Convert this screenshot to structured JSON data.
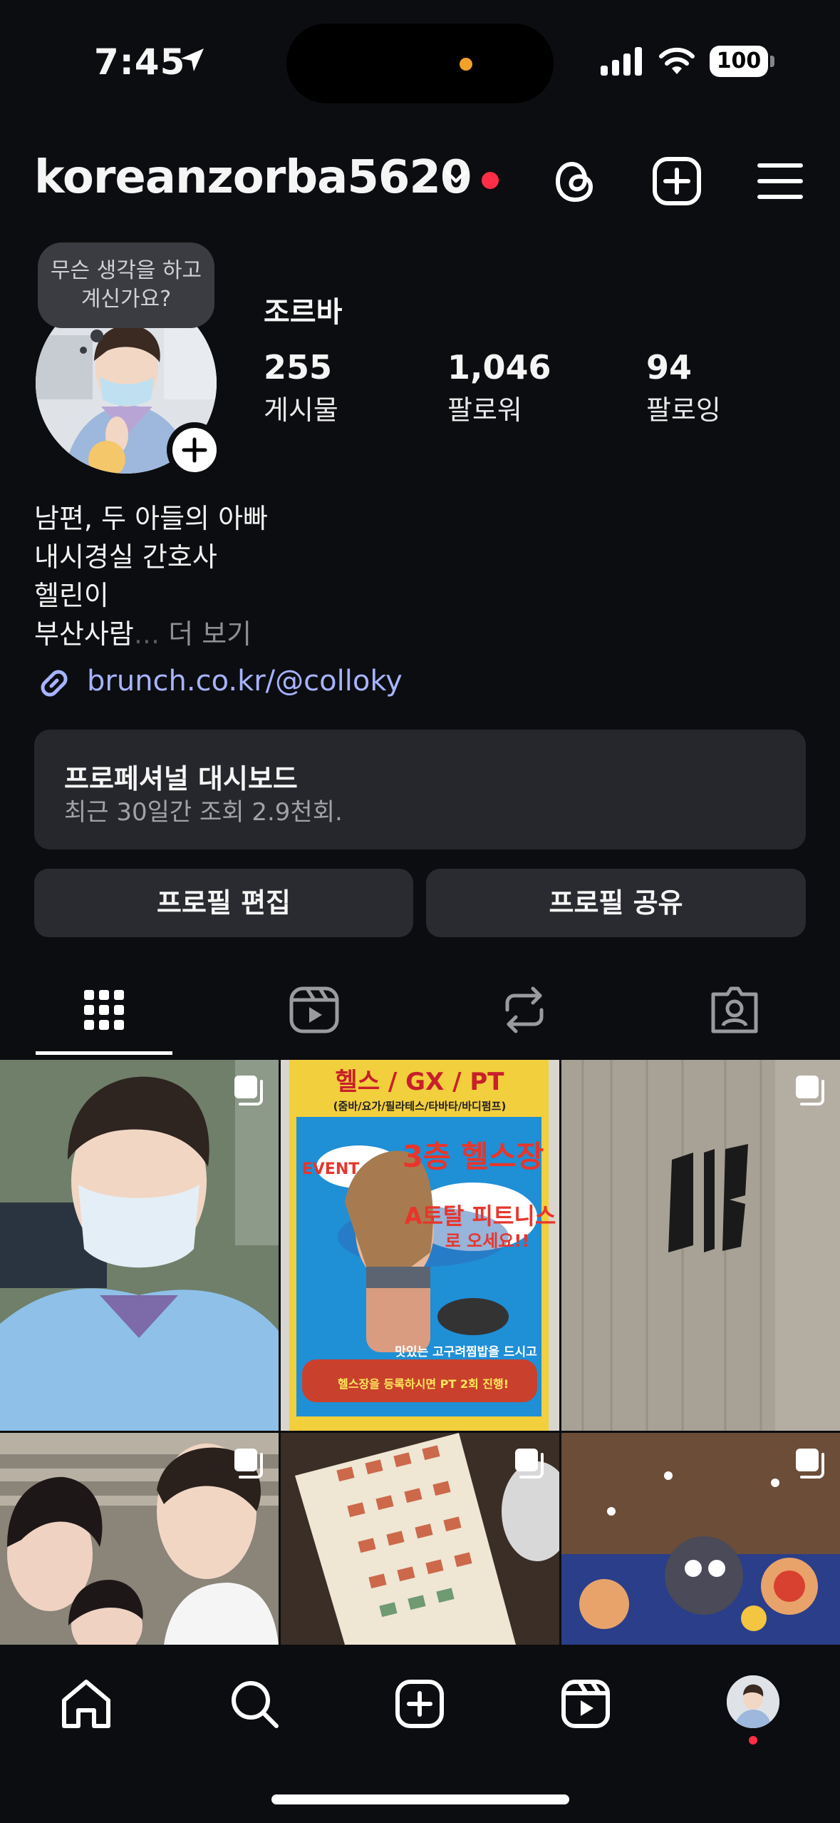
{
  "status_bar": {
    "time": "7:45",
    "battery": "100"
  },
  "header": {
    "username": "koreanzorba5620"
  },
  "profile": {
    "note": "무슨 생각을 하고 계신가요?",
    "display_name": "조르바",
    "stats": [
      {
        "value": "255",
        "label": "게시물"
      },
      {
        "value": "1,046",
        "label": "팔로워"
      },
      {
        "value": "94",
        "label": "팔로잉"
      }
    ],
    "bio": [
      "남편, 두 아들의 아빠",
      "내시경실 간호사",
      "헬린이",
      "부산사람"
    ],
    "bio_more": "더 보기",
    "bio_ellipsis": "...",
    "link": "brunch.co.kr/@colloky"
  },
  "dashboard": {
    "title": "프로페셔널 대시보드",
    "subtitle": "최근 30일간 조회 2.9천회."
  },
  "buttons": {
    "edit": "프로필 편집",
    "share": "프로필 공유"
  },
  "poster": {
    "heading": "헬스 / GX / PT",
    "subheading": "(줌바/요가/필라테스/타바타/바디펌프)",
    "badge": "EVENT",
    "floor": "3층 헬스장",
    "gym": "A토탈 피트니스",
    "come": "로 오세요!!",
    "meal": "맛있는 고구려찜밥을 드시고",
    "pt": "헬스장을 등록하시면 PT 2회 진행!"
  },
  "colors": {
    "background": "#0c0d10",
    "accent_link": "#a7b3ff",
    "notification": "#ff2d46",
    "surface": "#26272c"
  }
}
